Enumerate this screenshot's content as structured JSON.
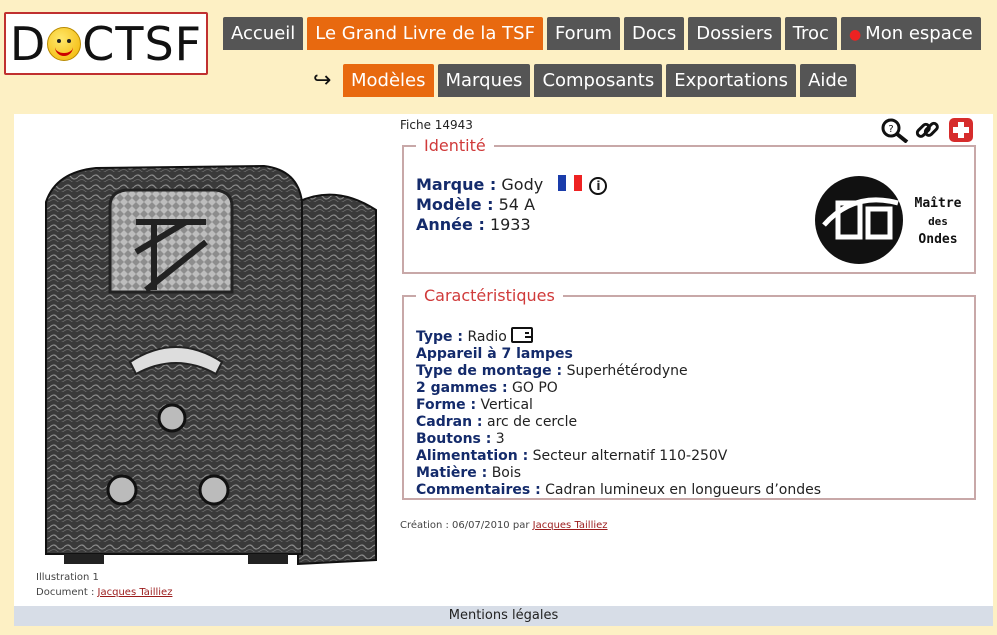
{
  "logo": {
    "text_left": "D",
    "text_right": "CTSF"
  },
  "nav_main": [
    {
      "label": "Accueil",
      "active": false
    },
    {
      "label": "Le Grand Livre de la TSF",
      "active": true
    },
    {
      "label": "Forum",
      "active": false
    },
    {
      "label": "Docs",
      "active": false
    },
    {
      "label": "Dossiers",
      "active": false
    },
    {
      "label": "Troc",
      "active": false
    },
    {
      "label": "Mon espace",
      "active": false
    }
  ],
  "nav_sub": [
    {
      "label": "Modèles",
      "active": true
    },
    {
      "label": "Marques",
      "active": false
    },
    {
      "label": "Composants",
      "active": false
    },
    {
      "label": "Exportations",
      "active": false
    },
    {
      "label": "Aide",
      "active": false
    }
  ],
  "fiche": "Fiche 14943",
  "tools": [
    "magnifier-icon",
    "link-icon",
    "add-plus-icon"
  ],
  "identite": {
    "legend": "Identité",
    "marque_label": "Marque :",
    "marque_value": "Gody",
    "modele_label": "Modèle :",
    "modele_value": "54 A",
    "annee_label": "Année :",
    "annee_value": "1933",
    "brand_logo_text": [
      "Maître",
      "des",
      "Ondes"
    ]
  },
  "caracteristiques": {
    "legend": "Caractéristiques",
    "rows": [
      {
        "label": "Type :",
        "value": "Radio"
      },
      {
        "label": "Appareil à 7 lampes",
        "value": ""
      },
      {
        "label": "Type de montage :",
        "value": "Superhétérodyne"
      },
      {
        "label": "2 gammes :",
        "value": "GO PO"
      },
      {
        "label": "Forme :",
        "value": "Vertical"
      },
      {
        "label": "Cadran :",
        "value": "arc de cercle"
      },
      {
        "label": "Boutons :",
        "value": "3"
      },
      {
        "label": "Alimentation :",
        "value": "Secteur alternatif 110-250V"
      },
      {
        "label": "Matière :",
        "value": "Bois"
      },
      {
        "label": "Commentaires :",
        "value": "Cadran lumineux en longueurs d’ondes"
      }
    ]
  },
  "creation": {
    "text": "Création : 06/07/2010 par",
    "author": "Jacques Tailliez"
  },
  "illustration": {
    "line1": "Illustration 1",
    "line2": "Document :",
    "author": "Jacques Tailliez"
  },
  "footer": "Mentions légales",
  "colors": {
    "background": "#fdf0c4",
    "tab": "#555555",
    "tab_active": "#e8690f",
    "legend": "#d03a3a",
    "label": "#142b6b"
  }
}
